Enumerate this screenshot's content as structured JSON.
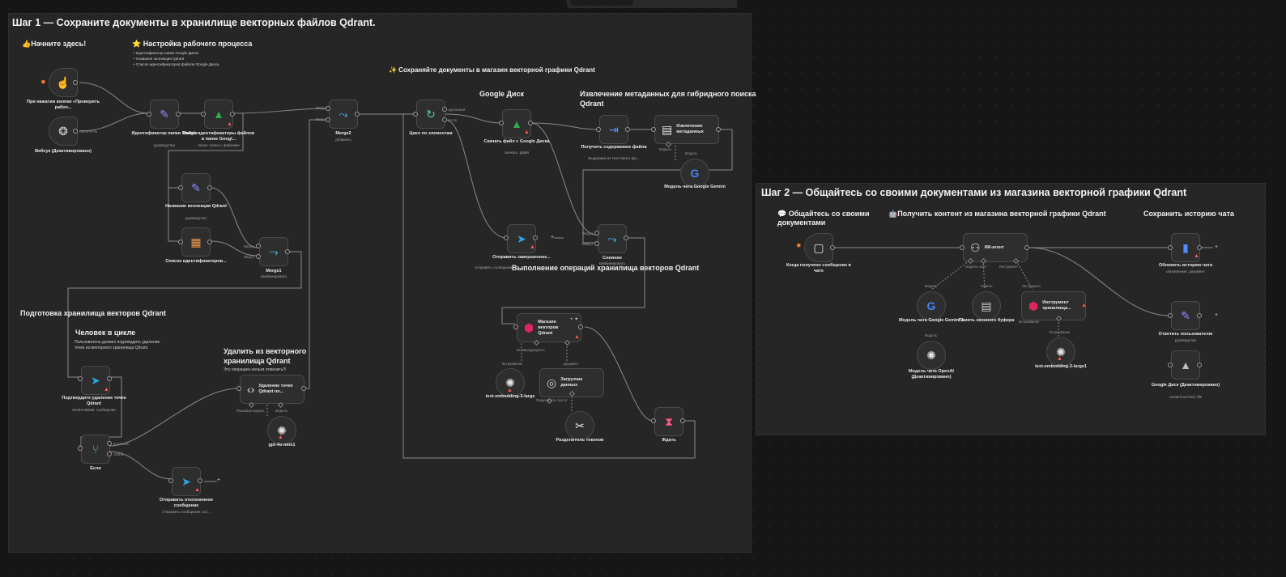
{
  "panel1": {
    "title": "Шаг 1 — Сохраните документы в хранилище векторных файлов Qdrant.",
    "start_here": "👍Начните здесь!",
    "workflow_setup": {
      "title": "⭐ Настройка рабочего процесса",
      "bullets": [
        "• Идентификатор папки Google Диска",
        "• Название коллекции Qdrant",
        "• Список идентификаторов файлов Google Диска"
      ]
    },
    "save_docs_title": "✨ Сохраняйте документы в магазин векторной графики Qdrant",
    "google_drive_title": "Google Диск",
    "metadata_title_1": "Извлечение метаданных для гибридного поиска",
    "metadata_title_2": "Qdrant",
    "qdrant_ops_title": "Выполнение операций хранилища векторов Qdrant",
    "prep_title": "Подготовка хранилища векторов Qdrant",
    "hitl_title": "Человек в цикле",
    "hitl_note_1": "Пользователь должен подтвердить удаление",
    "hitl_note_2": "точек из векторного хранилища Qdrant.",
    "delete_title_1": "Удалить из векторного",
    "delete_title_2": "хранилища Qdrant",
    "delete_note": "Эту операцию нельзя отменить!!!"
  },
  "panel2": {
    "title": "Шаг 2 — Общайтесь со своими документами из магазина векторной графики Qdrant",
    "chat_title_1": "💬 Общайтесь со своими",
    "chat_title_2": "документами",
    "get_content_title": "🤖Получить контент из магазина векторной графики Qdrant",
    "save_history_title": "Сохранить историю чата"
  },
  "nodes": {
    "manual_trigger": {
      "label": "При нажатии кнопки «Проверить рабоч...",
      "icon": "pointer-click-icon"
    },
    "webhook": {
      "label": "Вебхук (Деактивировано)",
      "icon": "webhook-icon",
      "port": "ПОЛУЧАТЬ"
    },
    "folder_id": {
      "label": "Идентификатор папки Google",
      "sub": "руководство",
      "icon": "pen-icon"
    },
    "find_ids": {
      "label": "Найти идентификаторы файлов в папке Googl...",
      "sub": "поиск: папка с файлами",
      "icon": "google-drive-icon"
    },
    "merge2": {
      "label": "Merge2",
      "sub": "добавить",
      "icon": "merge-icon",
      "in1": "Ввод 1",
      "in2": "Ввод 2"
    },
    "collection_name": {
      "label": "Название коллекции Qdrant",
      "sub": "руководство",
      "icon": "pen-icon"
    },
    "file_list": {
      "label": "Список идентификаторов...",
      "icon": "table-icon"
    },
    "merge1": {
      "label": "Merge1",
      "sub": "комбинировать",
      "icon": "merge-icon",
      "in1": "Ввод 1",
      "in2": "Ввод 2"
    },
    "loop": {
      "label": "Цикл по элементам",
      "icon": "loop-icon",
      "out1": "сделанный",
      "out2": "петля"
    },
    "download": {
      "label": "Скачать файл с Google Диска",
      "sub": "скачать: файл",
      "icon": "google-drive-icon"
    },
    "get_content": {
      "label": "Получить содержимое файла",
      "sub": "Выдержка из текстового фа...",
      "icon": "file-export-icon"
    },
    "extract_meta": {
      "label": "Извлечение метаданных",
      "icon": "document-icon",
      "port1": "Модель",
      "port2": "Модель"
    },
    "gemini_model": {
      "label": "Модель чата Google Gemini",
      "icon": "google-icon"
    },
    "send_done": {
      "label": "Отправить завершенное...",
      "sub": "отправить сообщение",
      "icon": "telegram-icon"
    },
    "merge_node": {
      "label": "Слияние",
      "sub": "комбинировать",
      "icon": "merge-icon",
      "in1": "Ввод 1",
      "in2": "Ввод 2"
    },
    "qdrant_store": {
      "label": "Магазин векторов Qdrant",
      "icon": "qdrant-icon",
      "port1": "Вставка/документ",
      "port2": "Встраивание",
      "port3": "Документ"
    },
    "embeddings": {
      "label": "text-embedding-3-large",
      "icon": "openai-icon"
    },
    "loader": {
      "label": "Загрузчик данных",
      "icon": "loader-icon",
      "port": "Разделитель текста"
    },
    "splitter": {
      "label": "Разделитель токенов",
      "icon": "scissors-icon"
    },
    "wait": {
      "label": "Ждать",
      "icon": "hourglass-icon"
    },
    "confirm_delete": {
      "label": "Подтвердите удаление точек Qdrant",
      "sub": "sendAndWait: сообщение",
      "icon": "telegram-icon"
    },
    "delete_points": {
      "label": "Удаление точек Qdrant по...",
      "icon": "code-icon",
      "port1": "Языковая модель",
      "port2": "Модель"
    },
    "gpt_mini": {
      "label": "gpt-4o-mini1",
      "icon": "openai-icon"
    },
    "if_node": {
      "label": "Если",
      "icon": "if-icon",
      "out1": "истинный",
      "out2": "ЛОЖЬ"
    },
    "send_reject": {
      "label": "Отправить отклоненное сообщение",
      "sub": "отправить сообщение соо...",
      "icon": "telegram-icon"
    },
    "chat_trigger": {
      "label": "Когда получено сообщение в чате",
      "icon": "chat-icon"
    },
    "ai_agent": {
      "label": "ИИ-агент",
      "icon": "robot-icon",
      "port1": "Модель чата *",
      "port2": "Память",
      "port3": "Инструмент"
    },
    "gemini1": {
      "label": "Модель чата Google Gemini 1",
      "icon": "google-icon",
      "port": "Модель"
    },
    "buffer": {
      "label": "Память оконного буфера",
      "icon": "memory-icon",
      "port": "Память"
    },
    "qdrant_tool": {
      "label": "Инструмент хранилища...",
      "icon": "qdrant-icon",
      "port": "Инструмент",
      "port2": "Встраивание"
    },
    "openai_chat": {
      "label": "Модель чата OpenAI (Деактивировано)",
      "icon": "openai-icon",
      "port": "Модель"
    },
    "embeddings2": {
      "label": "text-embedding-3-large1",
      "icon": "openai-icon",
      "port": "Встраивание"
    },
    "update_history": {
      "label": "Обновить историю чата",
      "sub": "обновление: документ",
      "icon": "google-docs-icon"
    },
    "reply_user": {
      "label": "Ответить пользователю",
      "sub": "руководство",
      "icon": "pen-icon"
    },
    "gdrive_deact": {
      "label": "Google Диск (Деактивировано)",
      "sub": "createFromText: file",
      "icon": "google-drive-icon"
    }
  },
  "colors": {
    "background": "#161616",
    "panel": "#262626",
    "node": "#2e2e2e",
    "edge": "#8a8a8a",
    "warning": "#ff5a5a",
    "trigger": "#ff7a2e"
  }
}
